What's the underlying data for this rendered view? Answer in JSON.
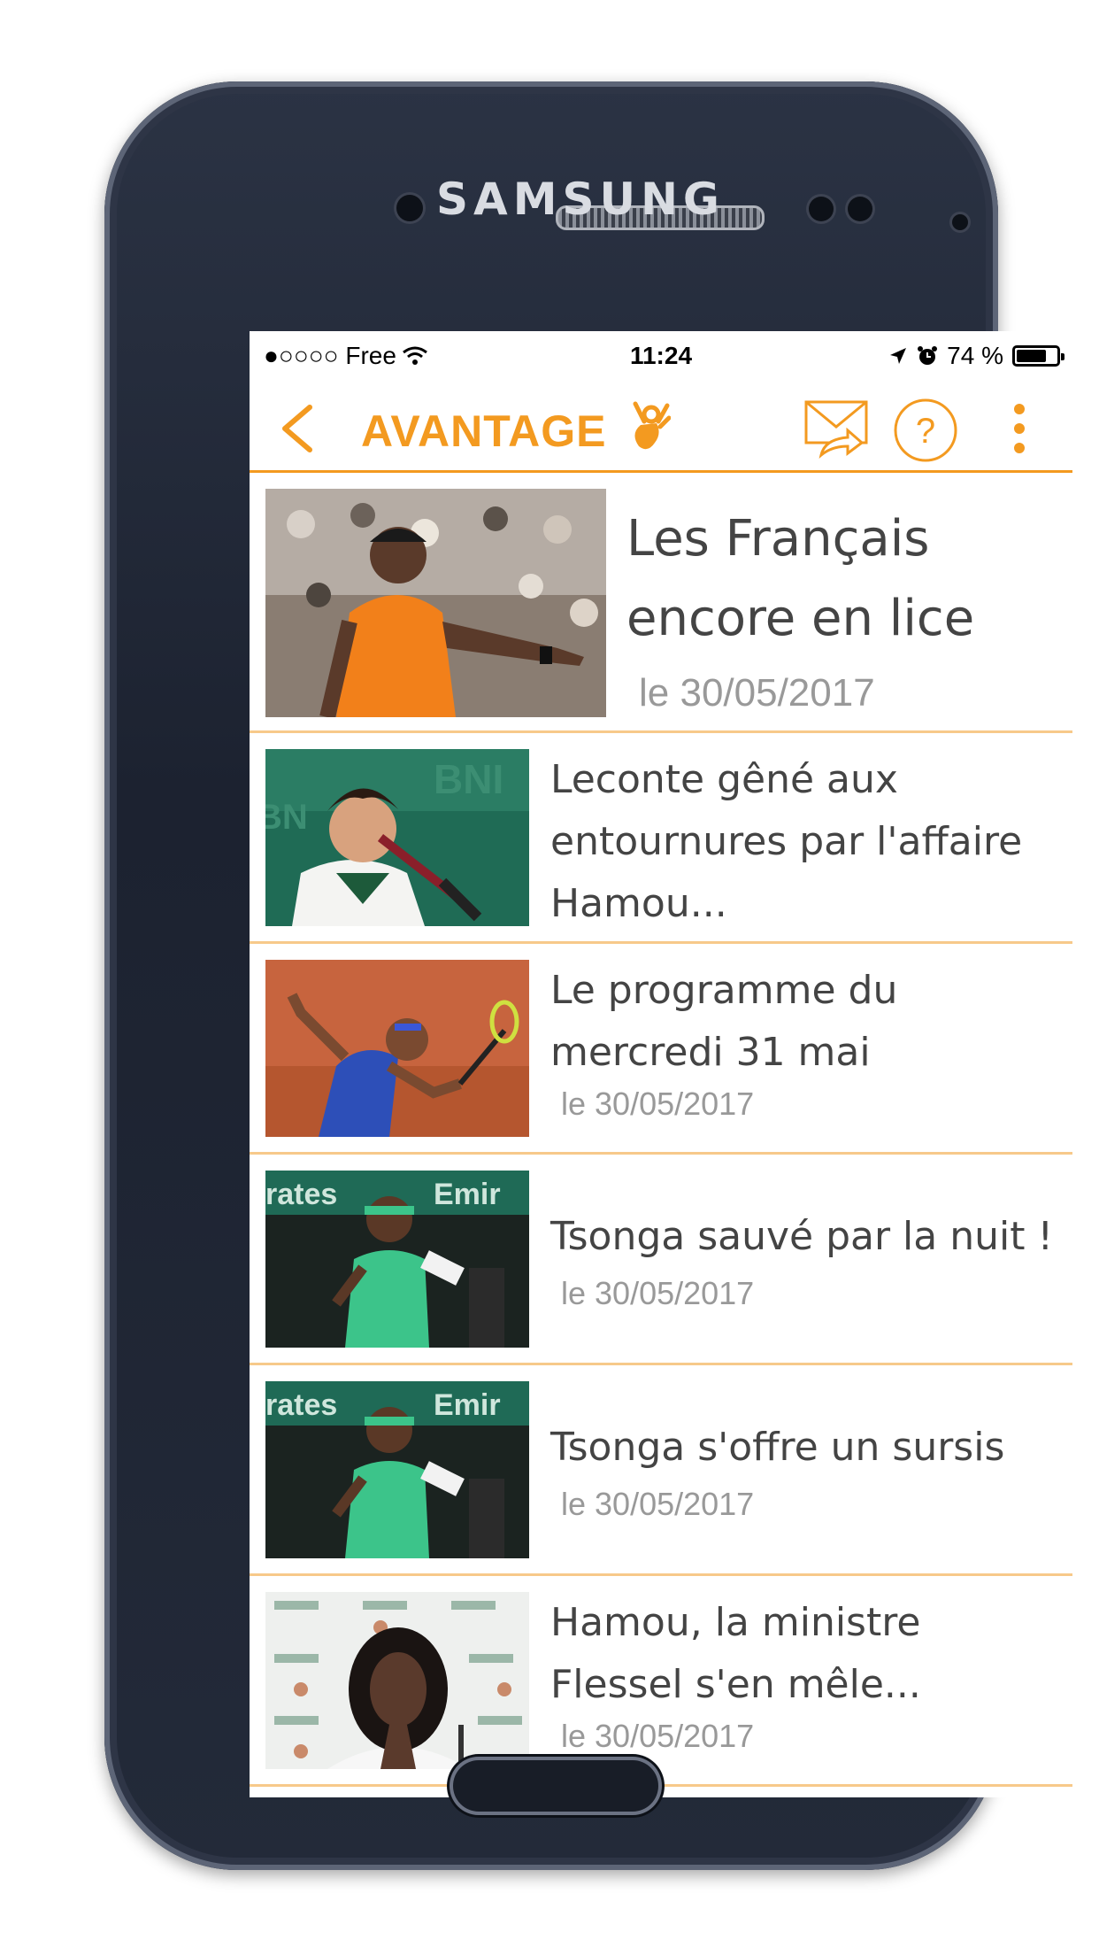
{
  "device": {
    "brand": "SAMSUNG"
  },
  "statusbar": {
    "carrier": "●○○○○ Free",
    "time": "11:24",
    "battery": "74 %",
    "battery_level": 0.74
  },
  "appbar": {
    "title": "AVANTAGE",
    "icons": [
      "back-chevron-icon",
      "hand-ok-logo-icon",
      "mail-share-icon",
      "help-icon",
      "more-vert-icon"
    ],
    "accent": "#f39a20"
  },
  "articles": [
    {
      "title": "Les Français encore en lice",
      "date": "le 30/05/2017"
    },
    {
      "title": "Leconte gêné aux entournures par l'affaire Hamou...",
      "date": ""
    },
    {
      "title": "Le programme du mercredi 31 mai",
      "date": "le 30/05/2017"
    },
    {
      "title": "Tsonga sauvé par la nuit !",
      "date": "le 30/05/2017"
    },
    {
      "title": "Tsonga s'offre un sursis",
      "date": "le 30/05/2017"
    },
    {
      "title": "Hamou, la ministre Flessel s'en mêle...",
      "date": "le 30/05/2017"
    }
  ]
}
